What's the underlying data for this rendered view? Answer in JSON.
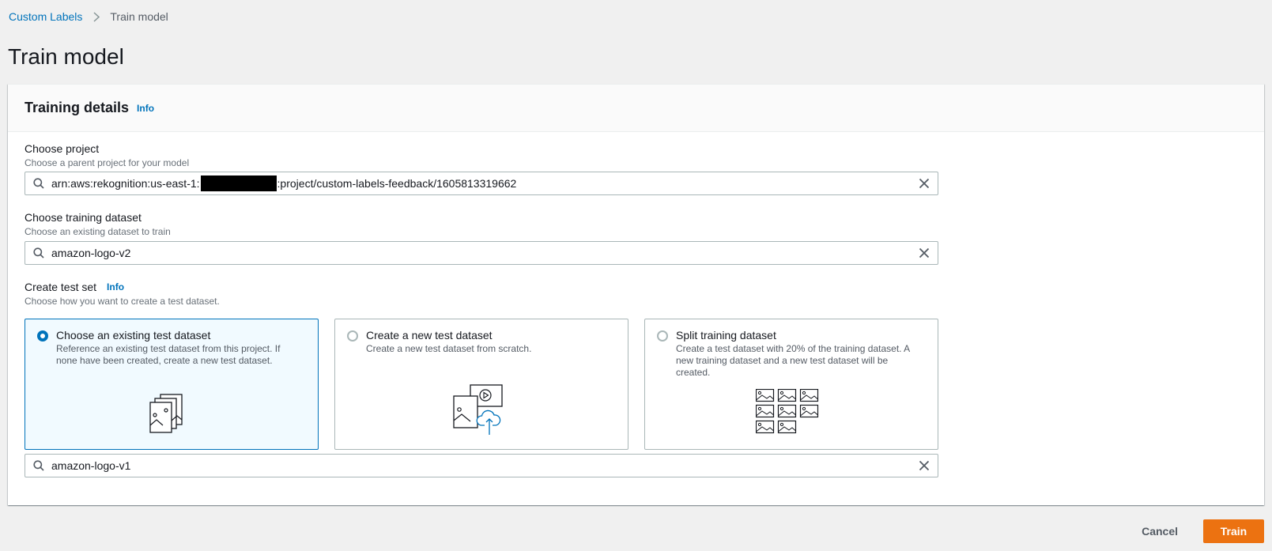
{
  "breadcrumb": {
    "parent": "Custom Labels",
    "current": "Train model"
  },
  "page": {
    "title": "Train model"
  },
  "training_details": {
    "title": "Training details",
    "info": "Info",
    "project": {
      "label": "Choose project",
      "description": "Choose a parent project for your model",
      "value_prefix": "arn:aws:rekognition:us-east-1:",
      "value_suffix": ":project/custom-labels-feedback/1605813319662"
    },
    "training_dataset": {
      "label": "Choose training dataset",
      "description": "Choose an existing dataset to train",
      "value": "amazon-logo-v2"
    },
    "test_set": {
      "label": "Create test set",
      "info": "Info",
      "description": "Choose how you want to create a test dataset.",
      "options": [
        {
          "title": "Choose an existing test dataset",
          "description": "Reference an existing test dataset from this project. If none have been created, create a new test dataset.",
          "selected": true
        },
        {
          "title": "Create a new test dataset",
          "description": "Create a new test dataset from scratch.",
          "selected": false
        },
        {
          "title": "Split training dataset",
          "description": "Create a test dataset with 20% of the training dataset. A new training dataset and a new test dataset will be created.",
          "selected": false
        }
      ],
      "selected_dataset": "amazon-logo-v1"
    }
  },
  "actions": {
    "cancel": "Cancel",
    "train": "Train"
  },
  "colors": {
    "link": "#0073bb",
    "primary_button": "#ec7211",
    "selected_tile_bg": "#f1faff"
  },
  "icons": [
    "chevron-right-icon",
    "search-icon",
    "close-icon",
    "images-stack-icon",
    "image-video-upload-icon",
    "image-grid-icon"
  ]
}
